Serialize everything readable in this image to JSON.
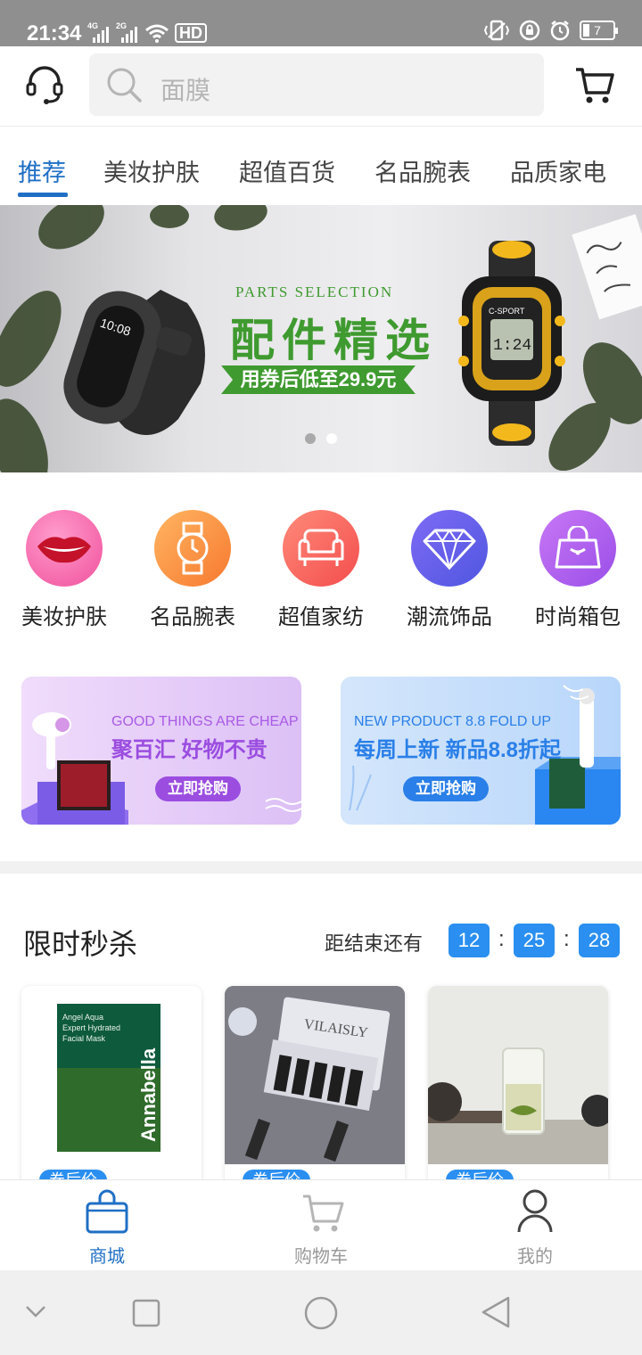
{
  "status_bar": {
    "time": "21:34",
    "signal_1": "4G",
    "signal_2": "2G",
    "hd_label": "HD",
    "battery": "7"
  },
  "search": {
    "placeholder": "面膜"
  },
  "tabs": [
    {
      "label": "推荐",
      "active": true
    },
    {
      "label": "美妆护肤"
    },
    {
      "label": "超值百货"
    },
    {
      "label": "名品腕表"
    },
    {
      "label": "品质家电"
    }
  ],
  "banner": {
    "subtitle": "PARTS SELECTION",
    "title": "配件精选",
    "ribbon": "用券后低至29.9元",
    "watch_display": "10:08",
    "watch_brand": "C-SPORT",
    "slide_count": 2,
    "active_slide": 2
  },
  "categories": [
    {
      "label": "美妆护肤",
      "icon": "lips-icon",
      "color": "#f35aa8"
    },
    {
      "label": "名品腕表",
      "icon": "watch-icon",
      "color": "#fb8e4a"
    },
    {
      "label": "超值家纺",
      "icon": "sofa-icon",
      "color": "#f95c5c"
    },
    {
      "label": "潮流饰品",
      "icon": "diamond-icon",
      "color": "#6a62ee"
    },
    {
      "label": "时尚箱包",
      "icon": "handbag-icon",
      "color": "#b15ef2"
    }
  ],
  "promos": [
    {
      "en": "GOOD THINGS ARE CHEAP",
      "cn": "聚百汇 好物不贵",
      "button": "立即抢购",
      "color": "#9b4de0"
    },
    {
      "en": "NEW PRODUCT 8.8 FOLD UP",
      "cn": "每周上新 新品8.8折起",
      "button": "立即抢购",
      "color": "#2a7fe8"
    }
  ],
  "flash_sale": {
    "title": "限时秒杀",
    "countdown_label": "距结束还有",
    "hours": "12",
    "minutes": "25",
    "seconds": "28",
    "separator": ":"
  },
  "products": [
    {
      "name": "Annabella",
      "badge": "券后价"
    },
    {
      "name": "VILAISLY",
      "badge": "券后价"
    },
    {
      "name": "tea",
      "badge": "券后价"
    }
  ],
  "bottom_nav": [
    {
      "label": "商城",
      "active": true
    },
    {
      "label": "购物车"
    },
    {
      "label": "我的"
    }
  ],
  "colors": {
    "accent": "#1f6fc5",
    "countdown": "#2a8ff0",
    "banner_green": "#3f9a2f"
  }
}
